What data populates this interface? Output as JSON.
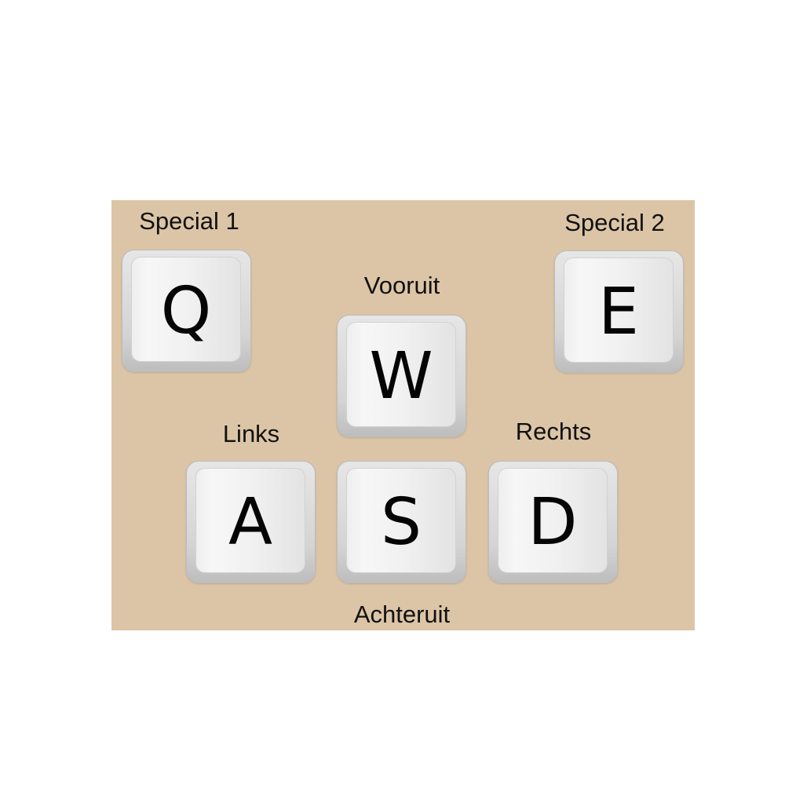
{
  "colors": {
    "panel": "#dcc5a6",
    "page": "#ffffff",
    "key_face": "#f2f2f2",
    "key_text": "#050505",
    "label_text": "#111111"
  },
  "keys": {
    "q": {
      "letter": "Q",
      "label": "Special 1"
    },
    "w": {
      "letter": "W",
      "label": "Vooruit"
    },
    "e": {
      "letter": "E",
      "label": "Special 2"
    },
    "a": {
      "letter": "A",
      "label": "Links"
    },
    "s": {
      "letter": "S",
      "label": "Achteruit"
    },
    "d": {
      "letter": "D",
      "label": "Rechts"
    }
  }
}
